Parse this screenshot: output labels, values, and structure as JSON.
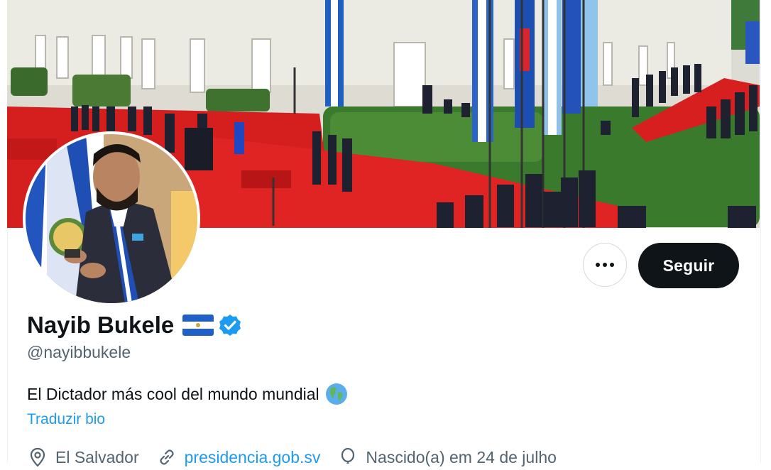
{
  "profile": {
    "display_name": "Nayib Bukele",
    "handle": "@nayibbukele",
    "bio": "El Dictador más cool del mundo mundial",
    "translate_bio": "Traduzir bio",
    "location": "El Salvador",
    "website": "presidencia.gob.sv",
    "birthday": "Nascido(a) em 24 de julho"
  },
  "actions": {
    "follow_label": "Seguir",
    "more_label": "···"
  },
  "icons": {
    "flag": "el-salvador-flag-icon",
    "verified": "verified-badge-icon",
    "globe": "globe-emoji-icon",
    "location": "location-pin-icon",
    "link": "link-icon",
    "birthday": "balloon-icon"
  },
  "colors": {
    "follow_button_bg": "#0f1419",
    "link_blue": "#1d9bf0",
    "secondary_text": "#536471",
    "verified_blue": "#1d9bf0"
  }
}
